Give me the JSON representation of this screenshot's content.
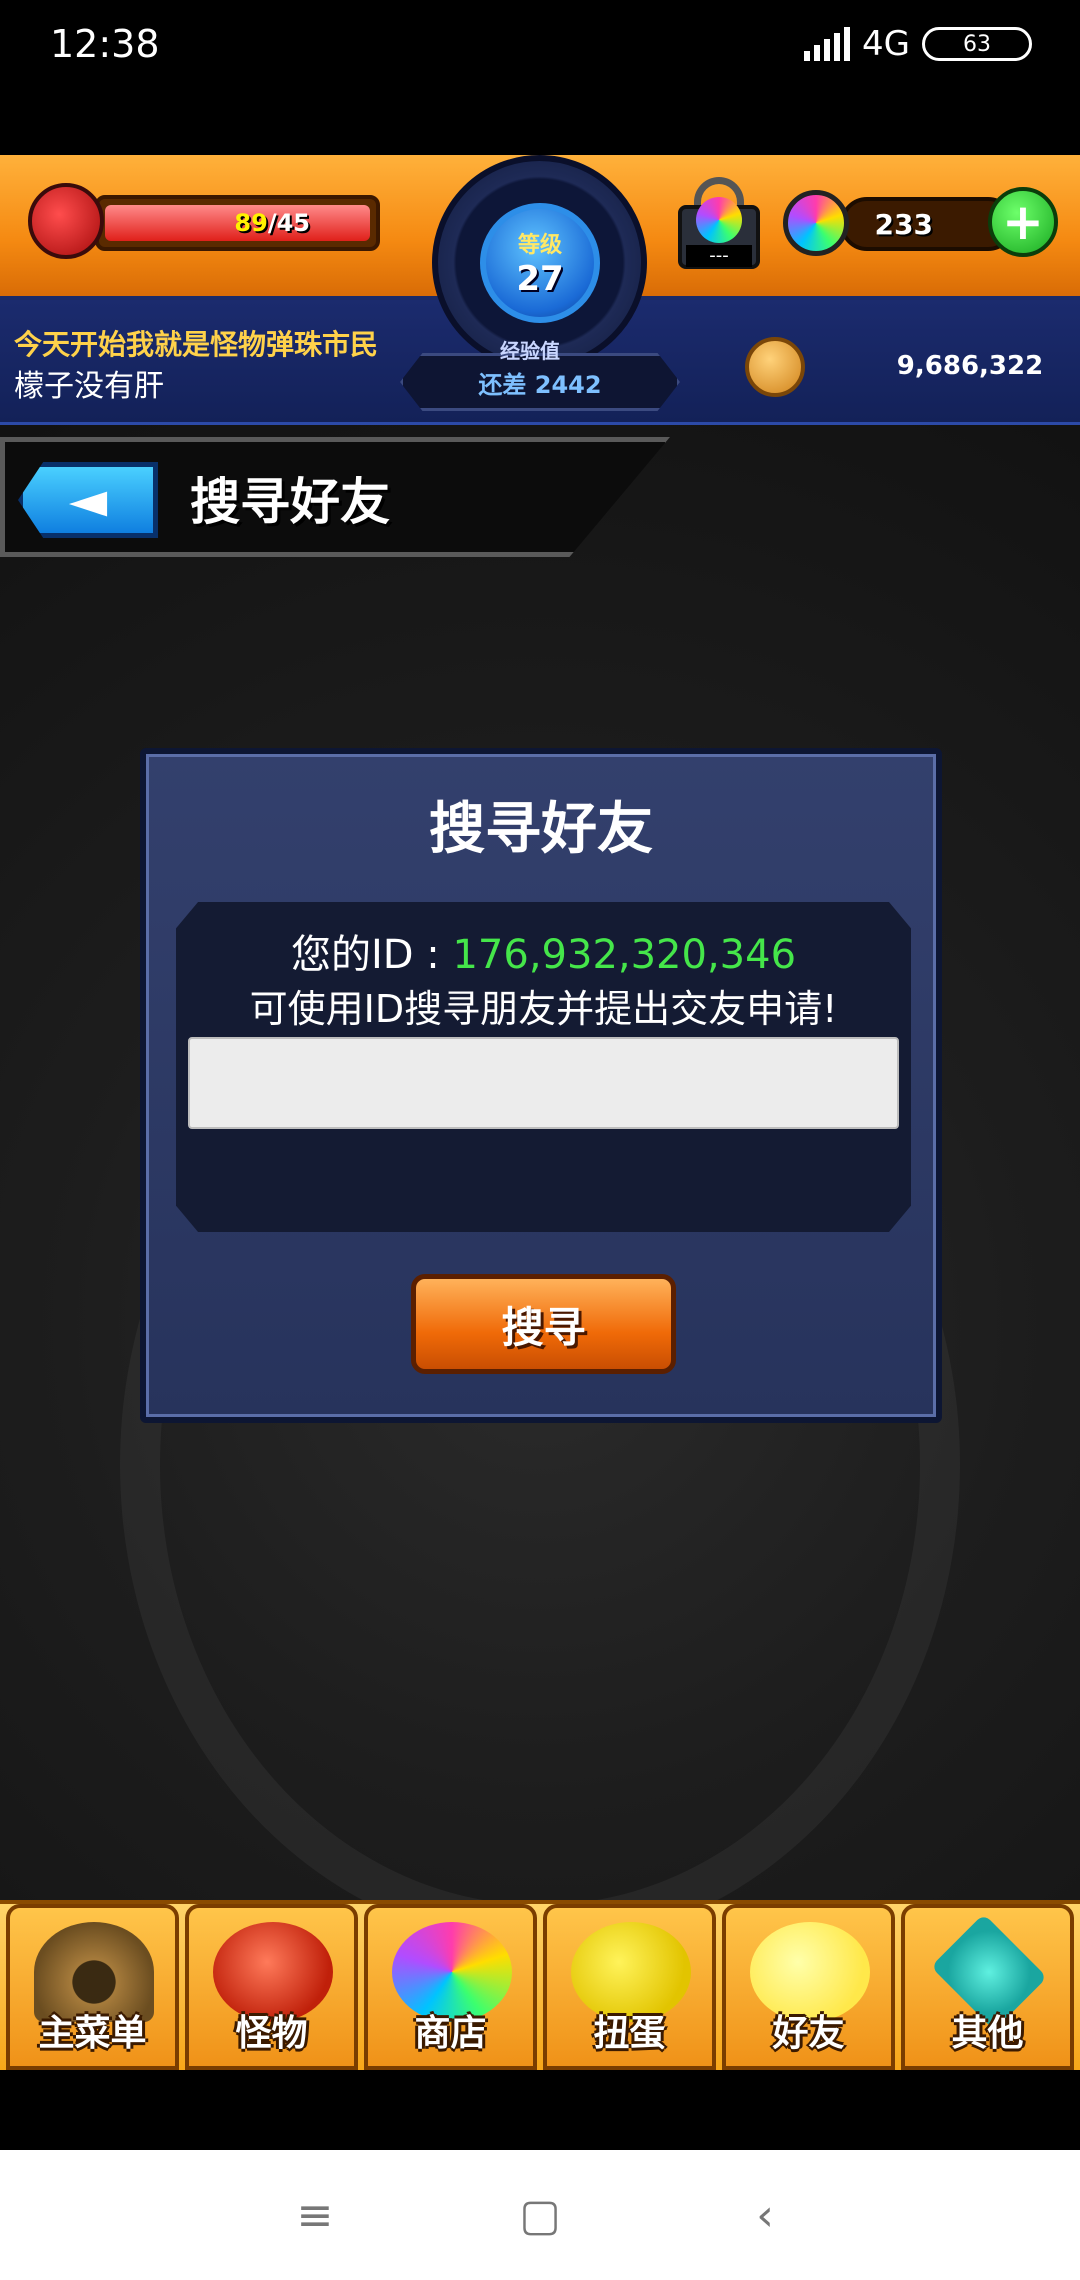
{
  "status_bar": {
    "time": "12:38",
    "network": "4G",
    "battery": "63"
  },
  "hud": {
    "stamina_current": "89",
    "stamina_max": "/45",
    "level_label": "等级",
    "level": "27",
    "exp_label": "经验值",
    "exp_remaining": "还差 2442",
    "lock_text": "---",
    "gems": "233",
    "plus_label": "+",
    "motto": "今天开始我就是怪物弹珠市民",
    "username": "檬子没有肝",
    "coins": "9,686,322"
  },
  "title_tab": {
    "title": "搜寻好友"
  },
  "dialog": {
    "title": "搜寻好友",
    "id_label": "您的ID : ",
    "id_value": "176,932,320,346",
    "hint": "可使用ID搜寻朋友并提出交友申请!",
    "input_value": "",
    "search_button": "搜寻"
  },
  "bottom_nav": {
    "items": [
      {
        "label": "主菜单",
        "icon": "main-menu-icon"
      },
      {
        "label": "怪物",
        "icon": "monster-icon"
      },
      {
        "label": "商店",
        "icon": "shop-icon"
      },
      {
        "label": "扭蛋",
        "icon": "gacha-icon"
      },
      {
        "label": "好友",
        "icon": "friends-icon"
      },
      {
        "label": "其他",
        "icon": "other-icon"
      }
    ]
  },
  "colors": {
    "id_value": "#45e64a",
    "hud_orange": "#f58a12",
    "hud_blue": "#1b2b6e"
  }
}
